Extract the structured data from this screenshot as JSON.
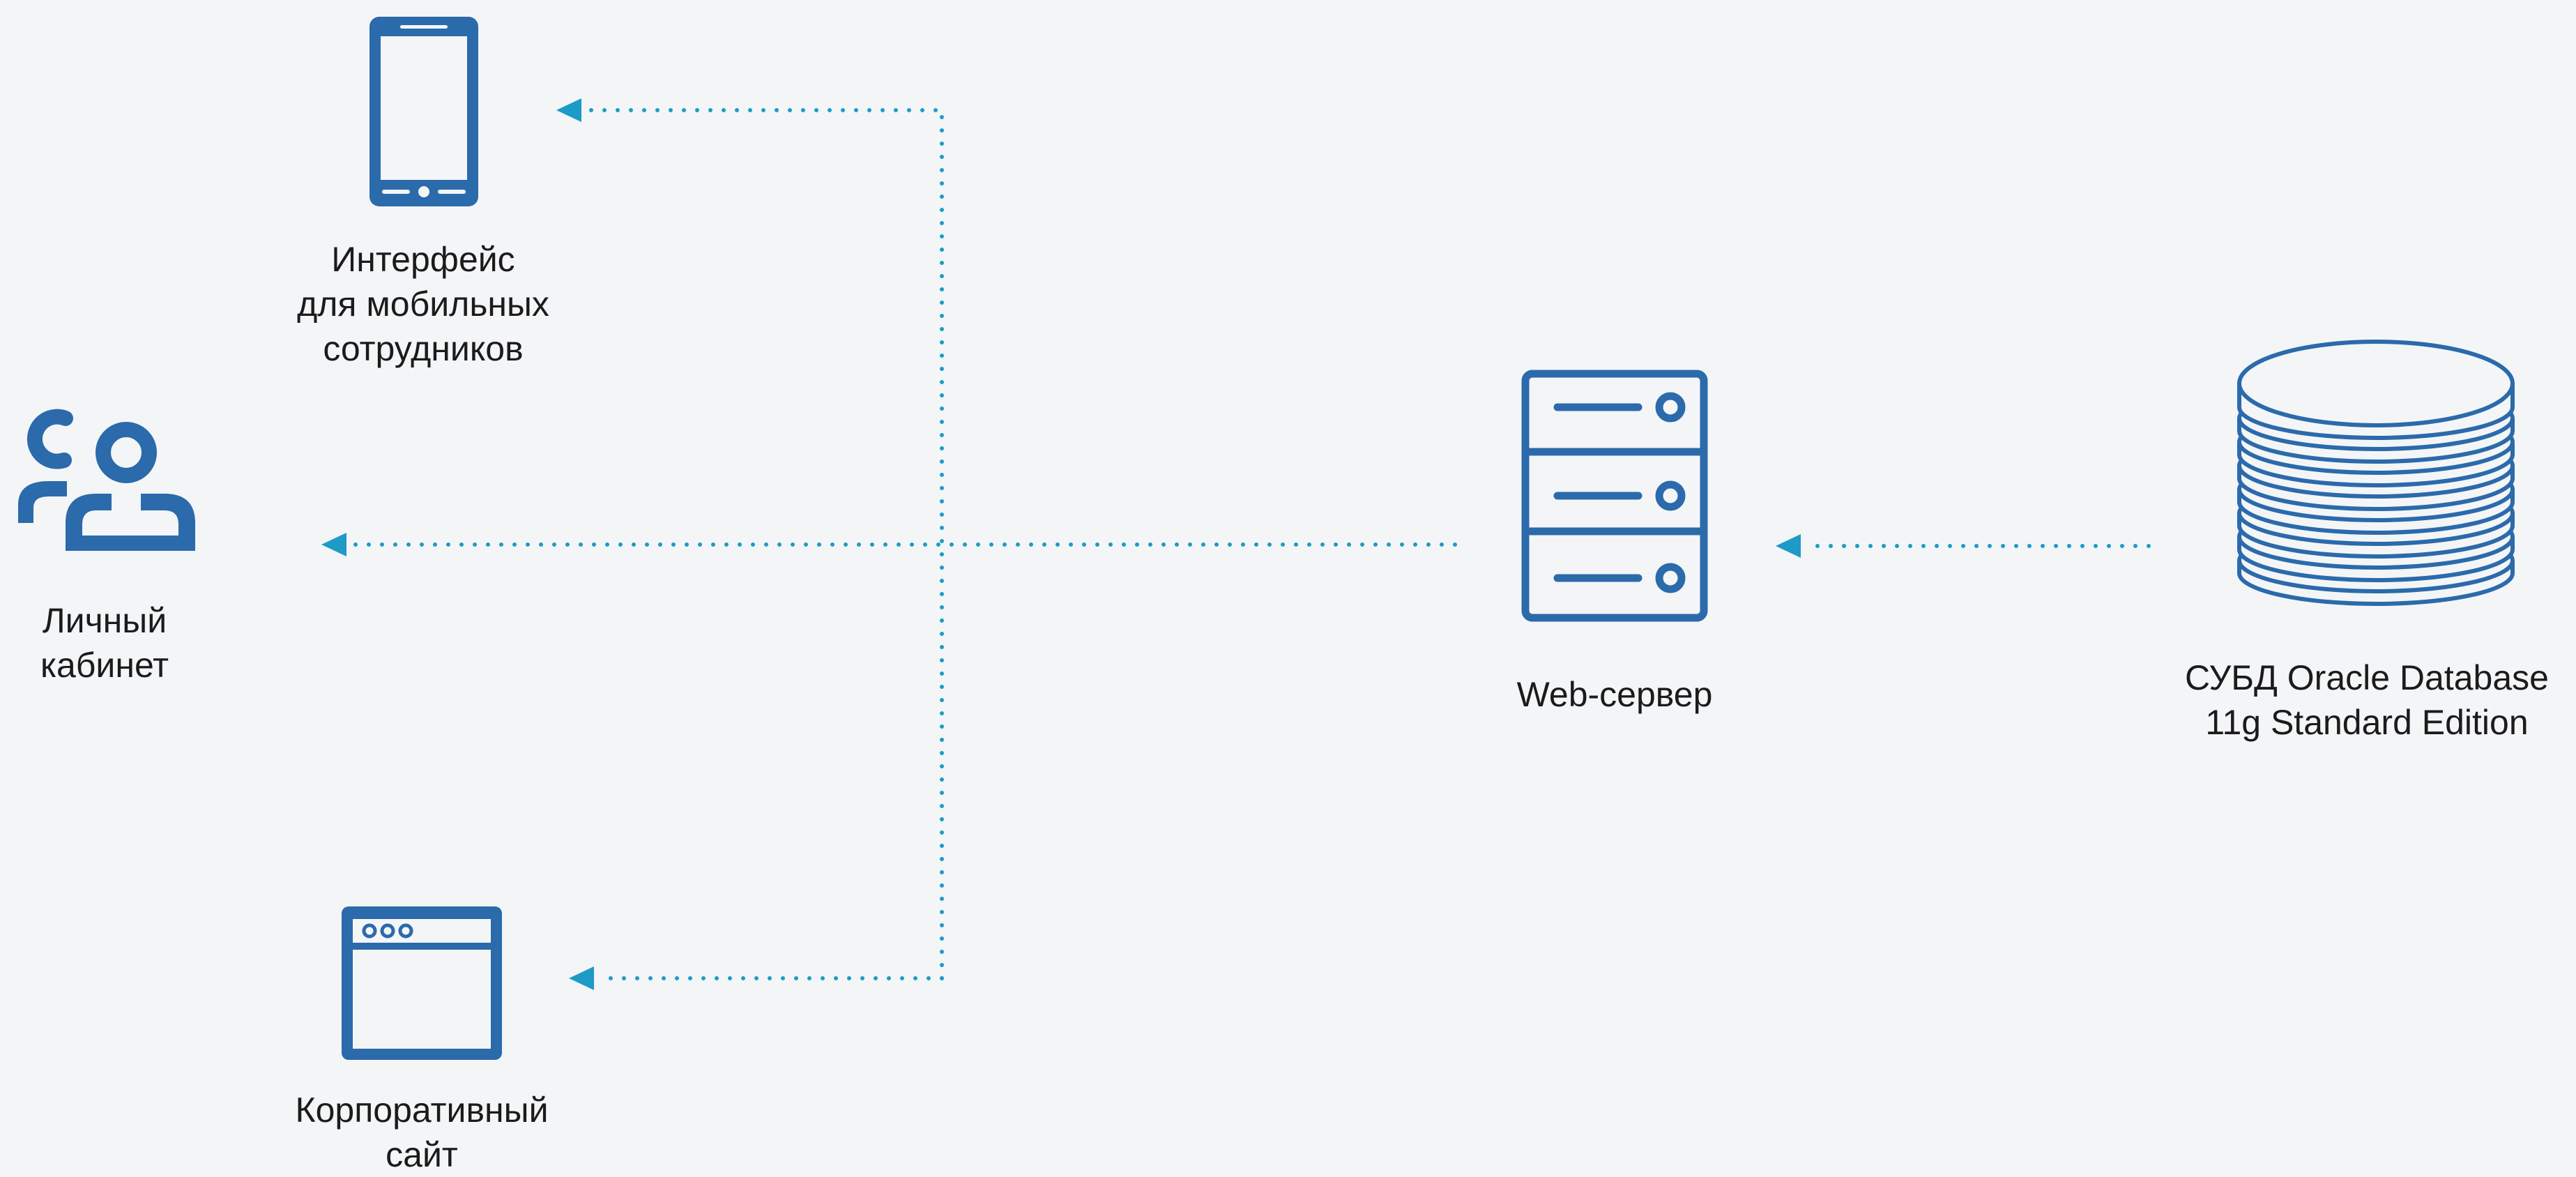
{
  "colors": {
    "background": "#f3f5f7",
    "icon": "#2b6aab",
    "connector": "#1d9bc6",
    "text": "#1b1b1b"
  },
  "nodes": {
    "mobile": {
      "icon": "smartphone-icon",
      "label_lines": [
        "Интерфейс",
        "для мобильных",
        "сотрудников"
      ]
    },
    "cabinet": {
      "icon": "users-icon",
      "label_lines": [
        "Личный",
        "кабинет"
      ]
    },
    "website": {
      "icon": "browser-window-icon",
      "label_lines": [
        "Корпоративный",
        "сайт"
      ]
    },
    "webserver": {
      "icon": "server-icon",
      "label_lines": [
        "Web-сервер"
      ]
    },
    "database": {
      "icon": "database-icon",
      "label_lines": [
        "СУБД Oracle Database",
        "11g Standard Edition"
      ]
    }
  },
  "connections": [
    {
      "from": "database",
      "to": "webserver"
    },
    {
      "from": "webserver",
      "to": "cabinet"
    },
    {
      "from": "webserver",
      "to": "mobile"
    },
    {
      "from": "webserver",
      "to": "website"
    }
  ]
}
